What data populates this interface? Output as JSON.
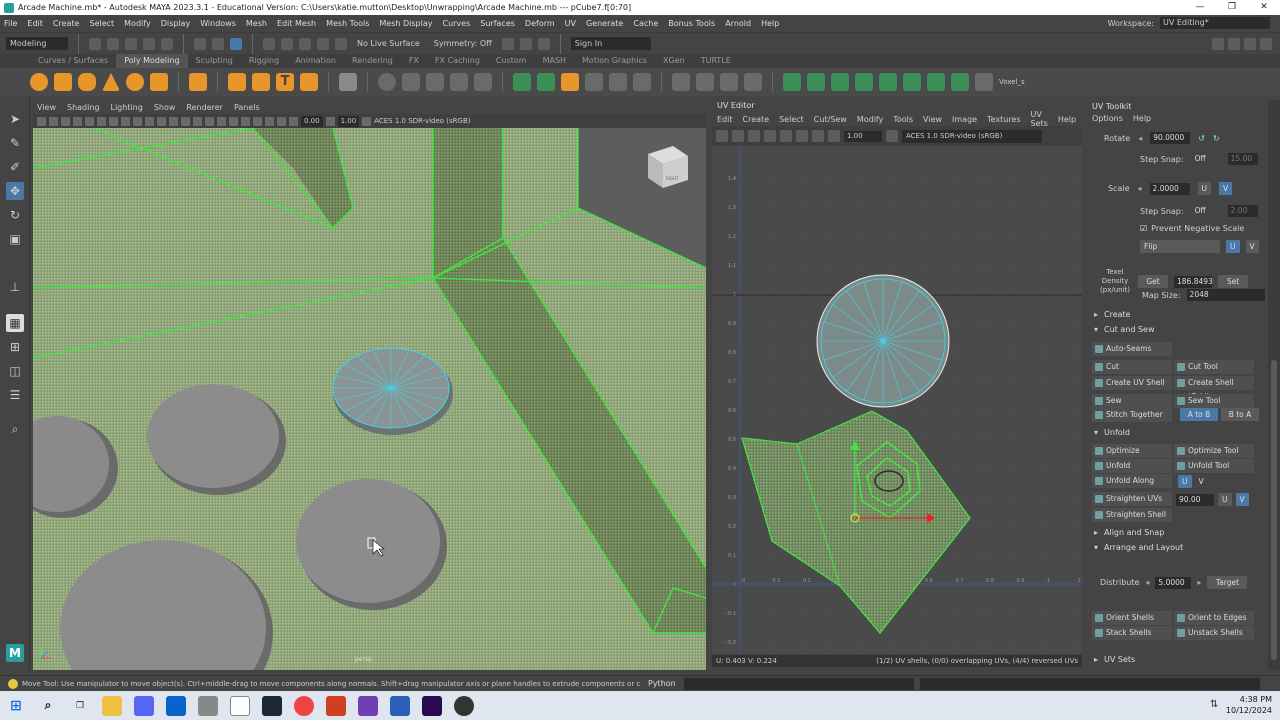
{
  "window": {
    "title": "Arcade Machine.mb* - Autodesk MAYA 2023.3.1 - Educational Version: C:\\Users\\katie.mutton\\Desktop\\Unwrapping\\Arcade Machine.mb --- pCube7.f[0:70]",
    "minimize": "—",
    "maximize": "❐",
    "close": "✕"
  },
  "menubar": {
    "items": [
      "File",
      "Edit",
      "Create",
      "Select",
      "Modify",
      "Display",
      "Windows",
      "Mesh",
      "Edit Mesh",
      "Mesh Tools",
      "Mesh Display",
      "Curves",
      "Surfaces",
      "Deform",
      "UV",
      "Generate",
      "Cache",
      "Bonus Tools",
      "Arnold",
      "Help"
    ],
    "workspace_label": "Workspace:",
    "workspace_value": "UV Editing*"
  },
  "statusline": {
    "mode": "Modeling",
    "live_surface": "No Live Surface",
    "symmetry": "Symmetry: Off",
    "sign_in": "Sign In"
  },
  "shelf": {
    "tabs": [
      "Curves / Surfaces",
      "Poly Modeling",
      "Sculpting",
      "Rigging",
      "Animation",
      "Rendering",
      "FX",
      "FX Caching",
      "Custom",
      "MASH",
      "Motion Graphics",
      "XGen",
      "TURTLE"
    ],
    "active_tab": "Poly Modeling",
    "right_label": "Voxel_s"
  },
  "viewport": {
    "menu": [
      "View",
      "Shading",
      "Lighting",
      "Show",
      "Renderer",
      "Panels"
    ],
    "field_a": "0.00",
    "field_b": "1.00",
    "colorspace": "ACES 1.0 SDR-video (sRGB)",
    "camera_label": "persp",
    "cube_label": "RIGHT"
  },
  "uv_editor": {
    "title": "UV Editor",
    "menu": [
      "Edit",
      "Create",
      "Select",
      "Cut/Sew",
      "Modify",
      "Tools",
      "View",
      "Image",
      "Textures",
      "UV Sets",
      "Help"
    ],
    "field": "1.00",
    "colorspace": "ACES 1.0 SDR-video (sRGB)",
    "status_left": "U: 0.403 V: 0.224",
    "status_right": "(1/2) UV shells, (0/0) overlapping UVs, (4/4) reversed UVs",
    "y_ticks": [
      "1.4",
      "1.3",
      "1.2",
      "1.1",
      "1",
      "0.9",
      "0.8",
      "0.7",
      "0.6",
      "0.5",
      "0.4",
      "0.3",
      "0.2",
      "0.1",
      "0",
      "-0.1",
      "-0.2"
    ],
    "x_ticks": [
      "0",
      "0.1",
      "0.2",
      "0.3",
      "0.4",
      "0.5",
      "0.6",
      "0.7",
      "0.8",
      "0.9",
      "1",
      "1.1"
    ]
  },
  "uv_toolkit": {
    "title": "UV Toolkit",
    "menu": [
      "Options",
      "Help"
    ],
    "rotate_label": "Rotate",
    "rotate_value": "90.0000",
    "step_snap_label": "Step Snap:",
    "step_snap_value": "Off",
    "step_snap_num1": "15.00",
    "scale_label": "Scale",
    "scale_value": "2.0000",
    "step_snap_num2": "2.00",
    "prevent_negative": "Prevent Negative Scale",
    "flip": "Flip",
    "u": "U",
    "v": "V",
    "texel_label": "Texel Density (px/unit)",
    "get": "Get",
    "texel_value": "186.8493",
    "set": "Set",
    "map_size_label": "Map Size:",
    "map_size_value": "2048",
    "sections": {
      "create": "Create",
      "cut_sew": "Cut and Sew",
      "unfold": "Unfold",
      "align_snap": "Align and Snap",
      "arrange": "Arrange and Layout",
      "uv_sets": "UV Sets"
    },
    "cut_sew_buttons": {
      "auto_seams": "Auto-Seams",
      "cut": "Cut",
      "cut_tool": "Cut Tool",
      "create_uv_shell": "Create UV Shell",
      "create_shell_grid": "Create Shell (Grid)",
      "sew": "Sew",
      "sew_tool": "Sew Tool",
      "stitch_together": "Stitch Together",
      "a_to_b": "A to B",
      "b_to_a": "B to A"
    },
    "unfold_buttons": {
      "optimize": "Optimize",
      "optimize_tool": "Optimize Tool",
      "unfold": "Unfold",
      "unfold_tool": "Unfold Tool",
      "unfold_along": "Unfold Along",
      "straighten_uvs": "Straighten UVs",
      "straighten_value": "90.00",
      "straighten_shell": "Straighten Shell"
    },
    "distribute_label": "Distribute",
    "distribute_value": "5.0000",
    "target": "Target",
    "arrange_buttons": {
      "orient_shells": "Orient Shells",
      "orient_to_edges": "Orient to Edges",
      "stack_shells": "Stack Shells",
      "unstack_shells": "Unstack Shells"
    }
  },
  "helpline": {
    "text": "Move Tool: Use manipulator to move object(s). Ctrl+middle-drag to move components along normals. Shift+drag manipulator axis or plane handles to extrude components or clone objects. Ctrl+Shift+drag to c",
    "python_label": "Python"
  },
  "taskbar": {
    "time": "4:38 PM",
    "date": "10/12/2024"
  },
  "colors": {
    "selection_green": "#3fe63f",
    "uv_cyan": "#3fd6e6",
    "accent_blue": "#4a79a8"
  }
}
